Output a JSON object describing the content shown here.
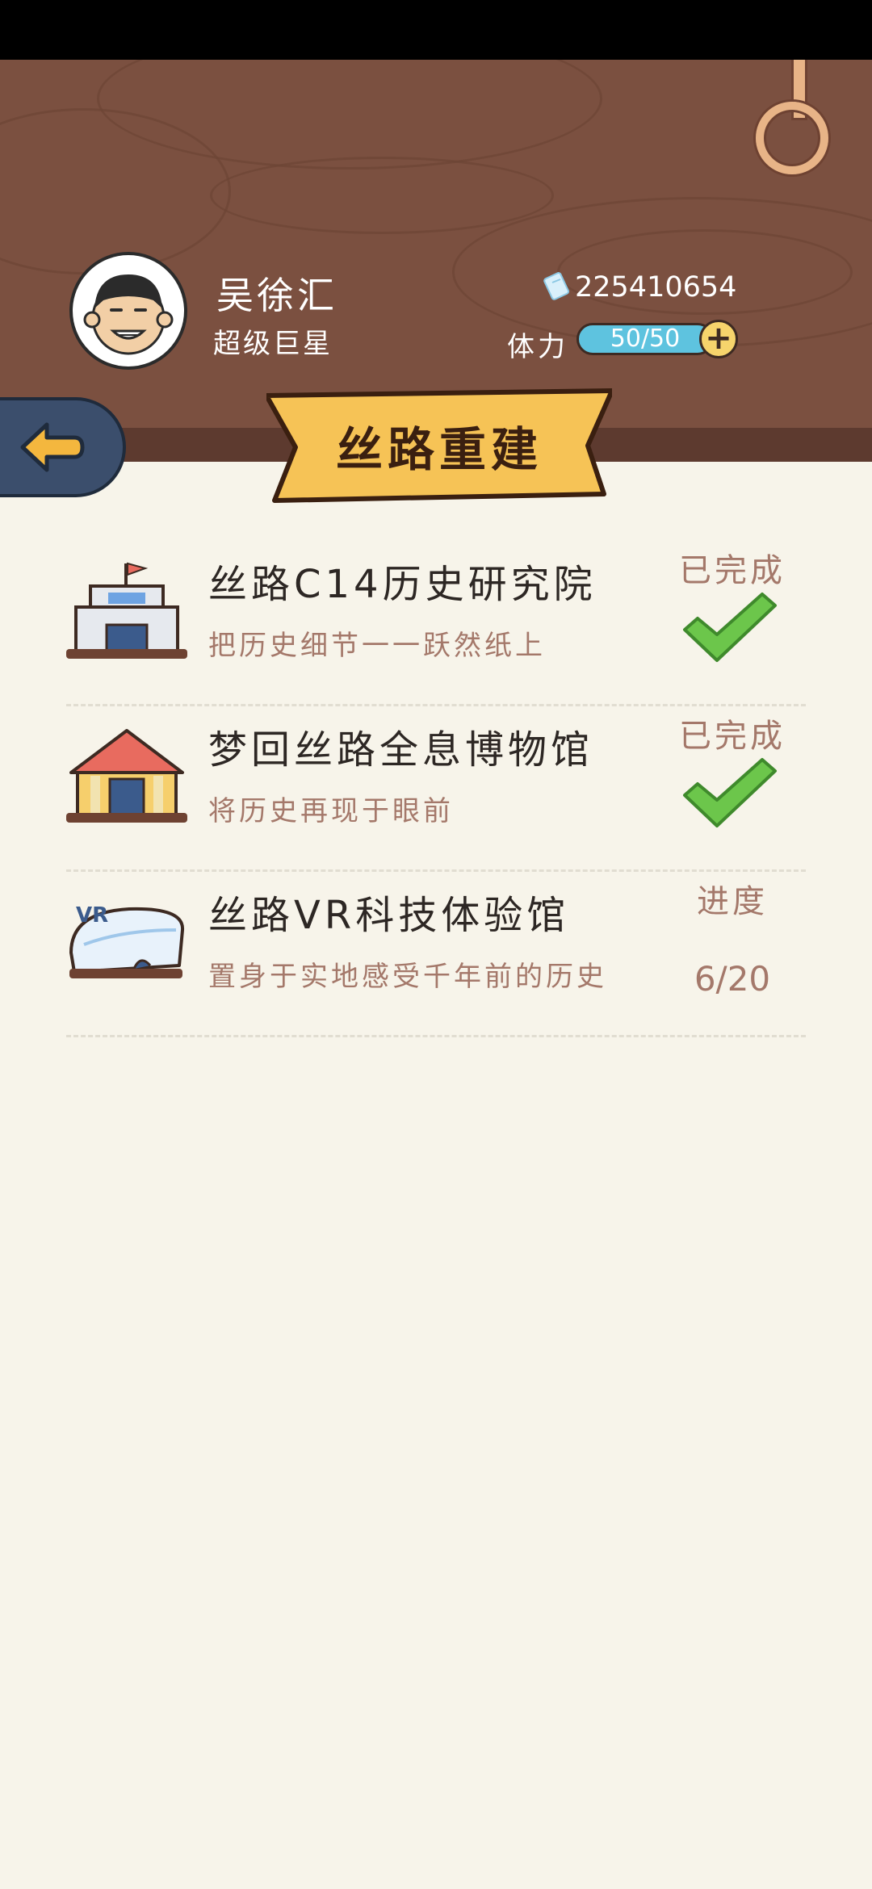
{
  "player": {
    "name": "吴徐汇",
    "title": "超级巨星",
    "coins": "225410654",
    "stamina_label": "体力",
    "stamina": "50/50"
  },
  "page": {
    "title": "丝路重建"
  },
  "items": [
    {
      "title": "丝路C14历史研究院",
      "desc": "把历史细节一一跃然纸上",
      "status": "已完成",
      "icon": "research-institute-icon"
    },
    {
      "title": "梦回丝路全息博物馆",
      "desc": "将历史再现于眼前",
      "status": "已完成",
      "icon": "museum-icon"
    },
    {
      "title": "丝路VR科技体验馆",
      "desc": "置身于实地感受千年前的历史",
      "status": "进度",
      "progress": "6/20",
      "icon": "vr-hall-icon"
    }
  ],
  "colors": {
    "header": "#7b5040",
    "background": "#f7f4ea",
    "banner": "#f6c356",
    "check": "#6cc64b",
    "accent_text": "#a4786a"
  }
}
